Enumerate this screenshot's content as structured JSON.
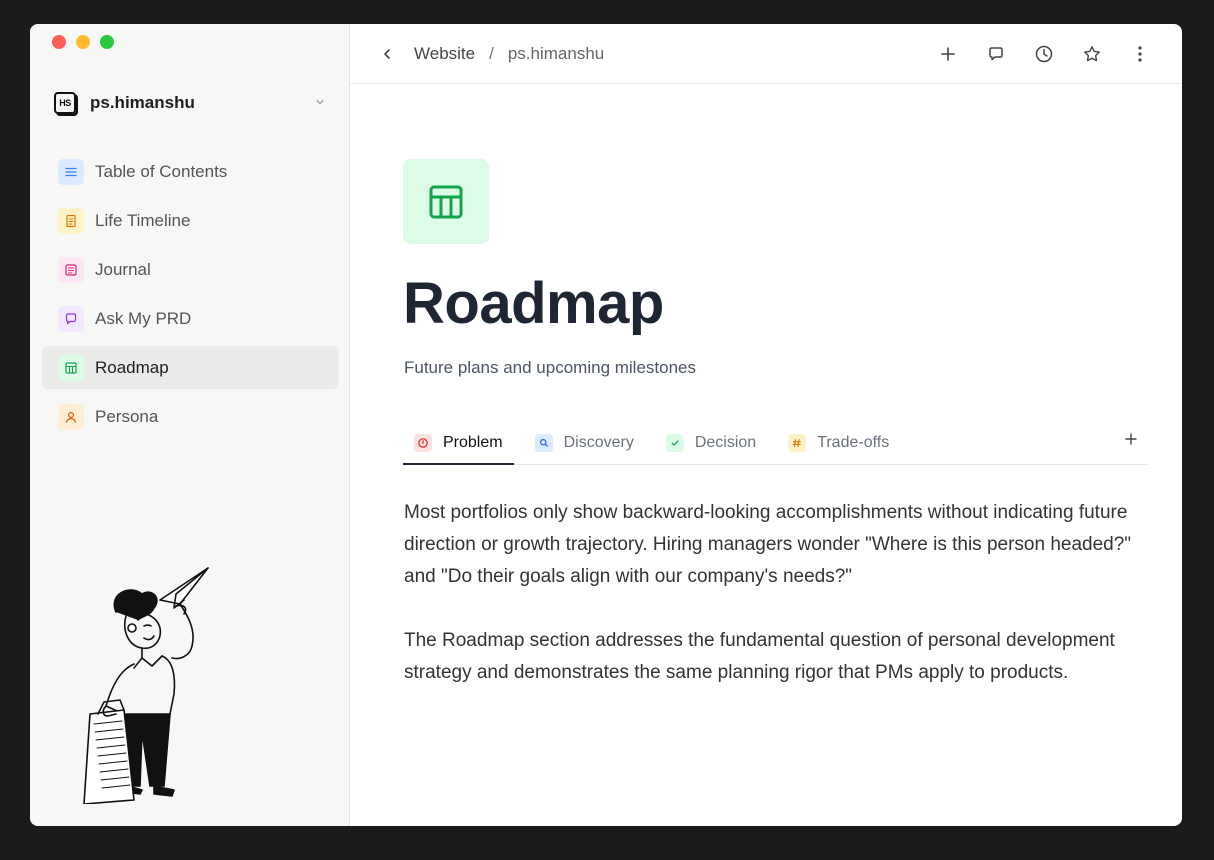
{
  "workspace": {
    "logo_text": "HS",
    "name": "ps.himanshu"
  },
  "sidebar": {
    "items": [
      {
        "label": "Table of Contents",
        "icon": "list-icon",
        "bg": "#dbeafe",
        "fg": "#3b82f6"
      },
      {
        "label": "Life Timeline",
        "icon": "document-icon",
        "bg": "#fef3c7",
        "fg": "#d97706"
      },
      {
        "label": "Journal",
        "icon": "journal-icon",
        "bg": "#fce7f3",
        "fg": "#db2777"
      },
      {
        "label": "Ask My PRD",
        "icon": "chat-icon",
        "bg": "#f3e8ff",
        "fg": "#9333ea"
      },
      {
        "label": "Roadmap",
        "icon": "table-icon",
        "bg": "#dcfce7",
        "fg": "#16a34a",
        "active": true
      },
      {
        "label": "Persona",
        "icon": "user-icon",
        "bg": "#ffedd5",
        "fg": "#ea580c"
      }
    ]
  },
  "breadcrumb": {
    "parent": "Website",
    "separator": "/",
    "current": "ps.himanshu"
  },
  "page": {
    "title": "Roadmap",
    "subtitle": "Future plans and upcoming milestones",
    "icon": "table-icon",
    "icon_color": "#16a34a"
  },
  "tabs": [
    {
      "label": "Problem",
      "icon": "alert-icon",
      "bg": "#fee2e2",
      "fg": "#dc2626",
      "active": true
    },
    {
      "label": "Discovery",
      "icon": "search-icon",
      "bg": "#dbeafe",
      "fg": "#2563eb"
    },
    {
      "label": "Decision",
      "icon": "check-icon",
      "bg": "#dcfce7",
      "fg": "#16a34a"
    },
    {
      "label": "Trade-offs",
      "icon": "hash-icon",
      "bg": "#fef3c7",
      "fg": "#d97706"
    }
  ],
  "content": {
    "paragraphs": [
      "Most portfolios only show backward-looking accomplishments without indicating future direction or growth trajectory. Hiring managers wonder \"Where is this person headed?\" and \"Do their goals align with our company's needs?\"",
      "The Roadmap section addresses the fundamental question of personal development strategy and demonstrates the same planning rigor that PMs apply to products."
    ]
  }
}
